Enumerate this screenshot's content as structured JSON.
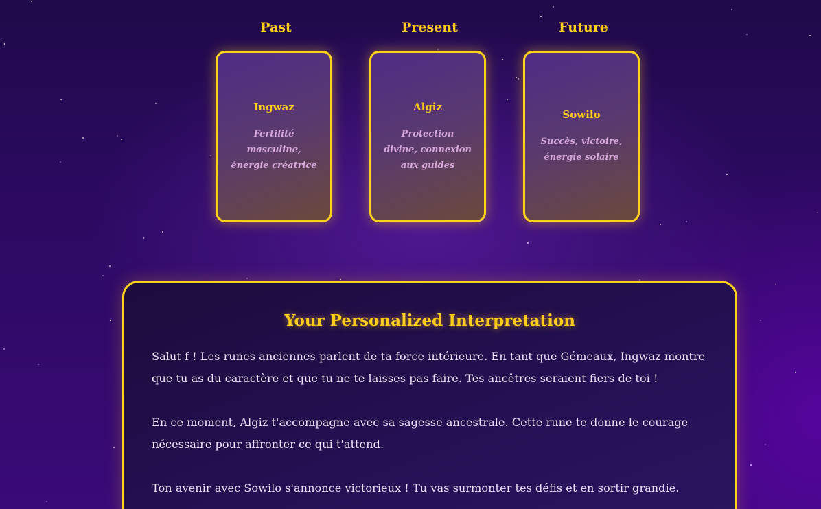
{
  "spread": {
    "positions": [
      {
        "label": "Past",
        "rune": "Ingwaz",
        "meaning": "Fertilité masculine, énergie créatrice"
      },
      {
        "label": "Present",
        "rune": "Algiz",
        "meaning": "Protection divine, connexion aux guides"
      },
      {
        "label": "Future",
        "rune": "Sowilo",
        "meaning": "Succès, victoire, énergie solaire"
      }
    ]
  },
  "interpretation": {
    "title": "Your Personalized Interpretation",
    "paragraphs": [
      "Salut f ! Les runes anciennes parlent de ta force intérieure. En tant que Gémeaux, Ingwaz montre que tu as du caractère et que tu ne te laisses pas faire. Tes ancêtres seraient fiers de toi !",
      "En ce moment, Algiz t'accompagne avec sa sagesse ancestrale. Cette rune te donne le courage nécessaire pour affronter ce qui t'attend.",
      "Ton avenir avec Sowilo s'annonce victorieux ! Tu vas surmonter tes défis et en sortir grandie."
    ]
  },
  "colors": {
    "accent": "#ffd21a",
    "title_text": "#ffcc1a",
    "meaning_text": "#d8a8dc",
    "background": "#2a0a5e"
  }
}
